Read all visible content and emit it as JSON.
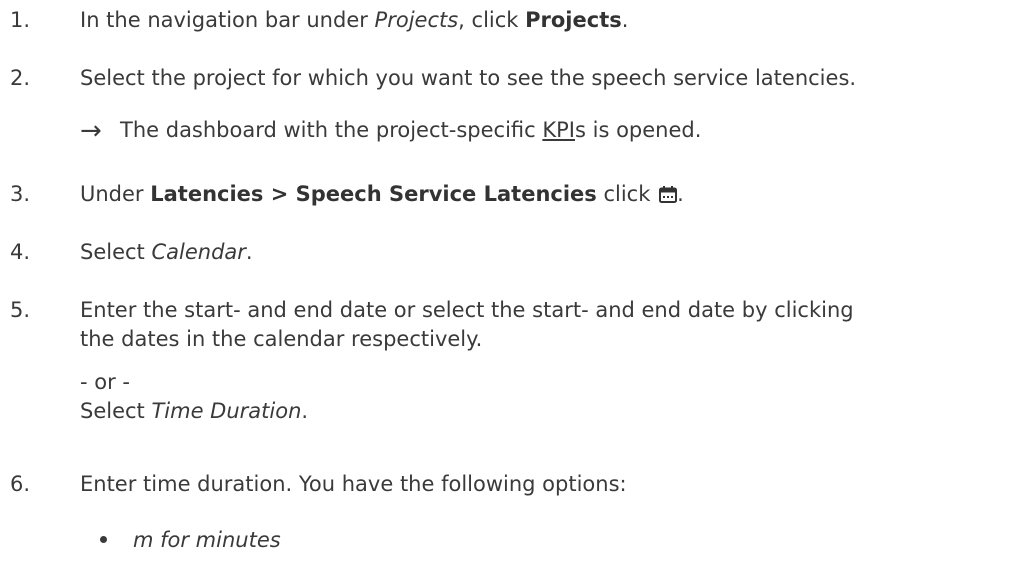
{
  "steps": [
    {
      "number": "1.",
      "pre": "In the navigation bar under ",
      "italic": "Projects",
      "mid": ", click ",
      "bold": "Projects",
      "post": "."
    },
    {
      "number": "2.",
      "text": "Select the project for which you want to see the speech service latencies.",
      "result": {
        "arrow": "→",
        "pre": "The dashboard with the project-specific ",
        "link": "KPI",
        "post": "s is opened."
      }
    },
    {
      "number": "3.",
      "pre": "Under ",
      "bold": "Latencies > Speech Service Latencies",
      "post": " click ",
      "icon": "calendar-icon",
      "end": "."
    },
    {
      "number": "4.",
      "pre": "Select ",
      "italic": "Calendar",
      "post": "."
    },
    {
      "number": "5.",
      "line1": "Enter the start- and end date or select the start- and end date by clicking",
      "line2": "the dates in the calendar respectively.",
      "or": "- or -",
      "alt_pre": "Select ",
      "alt_italic": "Time Duration",
      "alt_post": "."
    },
    {
      "number": "6.",
      "text": "Enter time duration. You have the following options:",
      "options": [
        "m for minutes"
      ]
    }
  ]
}
